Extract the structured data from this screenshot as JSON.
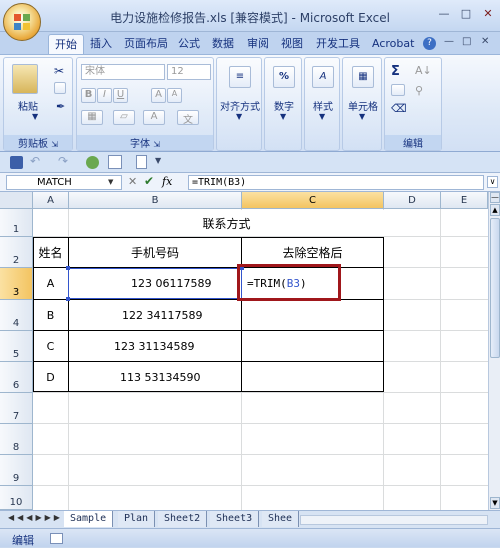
{
  "window": {
    "title": "电力设施检修报告.xls  [兼容模式] - Microsoft Excel"
  },
  "tabs": [
    "开始",
    "插入",
    "页面布局",
    "公式",
    "数据",
    "审阅",
    "视图",
    "开发工具",
    "Acrobat"
  ],
  "ribbon": {
    "clipboard": {
      "label": "剪贴板",
      "paste": "粘贴"
    },
    "font": {
      "label": "字体",
      "font_name": "宋体",
      "font_size": "12",
      "bold": "B",
      "italic": "I",
      "underline": "U"
    },
    "alignment": {
      "label": "对齐方式"
    },
    "number": {
      "label": "数字",
      "symbol": "%"
    },
    "styles": {
      "label": "样式"
    },
    "cells": {
      "label": "单元格"
    },
    "editing": {
      "label": "编辑",
      "sum": "Σ"
    }
  },
  "formula_bar": {
    "name_box": "MATCH",
    "fx": "fx",
    "formula": "=TRIM(B3)"
  },
  "columns": [
    "A",
    "B",
    "C",
    "D",
    "E"
  ],
  "rows": [
    "1",
    "2",
    "3",
    "4",
    "5",
    "6",
    "7",
    "8",
    "9",
    "10"
  ],
  "sheet": {
    "title": "联系方式",
    "header_name": "姓名",
    "header_phone": "手机号码",
    "header_result": "去除空格后",
    "rows": [
      {
        "name": "A",
        "phone": "123 06117589"
      },
      {
        "name": "B",
        "phone": "122 34117589"
      },
      {
        "name": "C",
        "phone": "123 31134589"
      },
      {
        "name": "D",
        "phone": "113 53134590"
      }
    ],
    "edit_prefix": "=TRIM(",
    "edit_ref": "B3",
    "edit_suffix": ")"
  },
  "sheet_tabs": [
    "Sample",
    "Plan",
    "Sheet2",
    "Sheet3",
    "Shee"
  ],
  "status": {
    "mode": "编辑"
  },
  "colors": {
    "ref_blue": "#3355cc",
    "highlight_box": "#a0171b",
    "selected_header": "#f3c461"
  }
}
